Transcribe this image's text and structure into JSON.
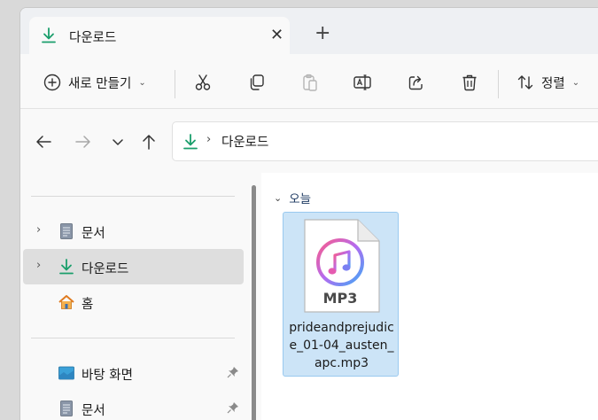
{
  "tab": {
    "title": "다운로드",
    "close_glyph": "✕",
    "new_tab_glyph": "+"
  },
  "toolbar": {
    "new_label": "새로 만들기",
    "sort_label": "정렬",
    "caret": "⌄",
    "icons": [
      "plus-circle-icon",
      "cut-icon",
      "copy-icon",
      "paste-icon",
      "rename-icon",
      "share-icon",
      "delete-icon",
      "sort-icon"
    ]
  },
  "address": {
    "chevron": "›",
    "path": "다운로드"
  },
  "nav": {
    "chevron": "›",
    "items": [
      {
        "label": "문서"
      },
      {
        "label": "다운로드"
      },
      {
        "label": "홈"
      }
    ],
    "quick_access": [
      {
        "label": "바탕 화면"
      },
      {
        "label": "문서"
      }
    ]
  },
  "content": {
    "group_label": "오늘",
    "group_chevron": "⌄",
    "file": {
      "badge": "MP3",
      "name": "prideandprejudice_01-04_austen_apc.mp3"
    }
  },
  "colors": {
    "accent_green": "#1a9e6b",
    "selection": "#cce4f7",
    "selection_border": "#99c9ef"
  }
}
